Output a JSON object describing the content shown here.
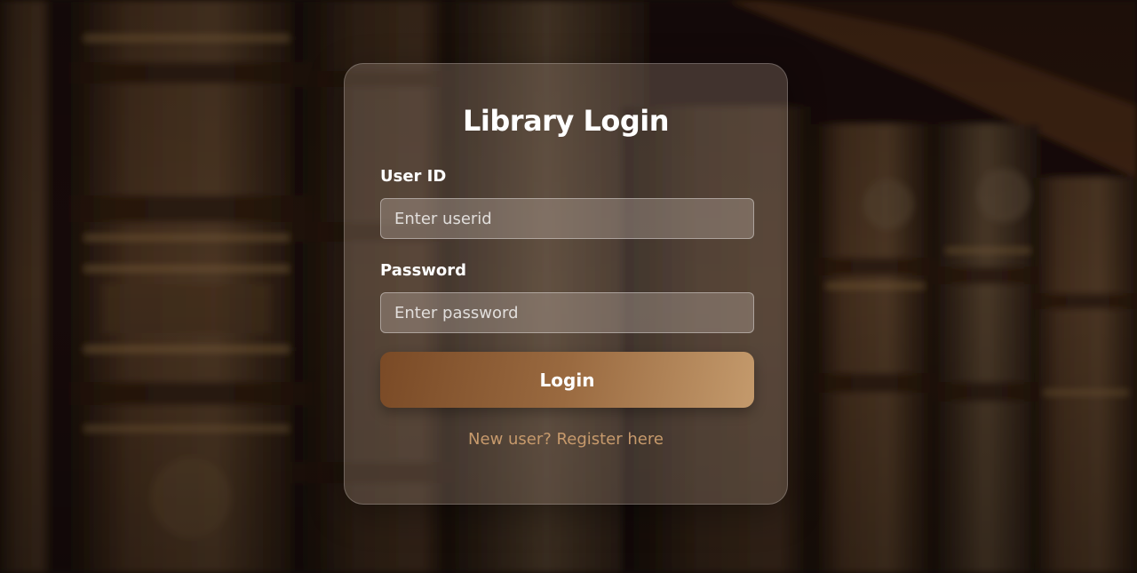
{
  "login": {
    "title": "Library Login",
    "userid_label": "User ID",
    "userid_placeholder": "Enter userid",
    "password_label": "Password",
    "password_placeholder": "Enter password",
    "button_label": "Login",
    "register_link": "New user? Register here"
  },
  "colors": {
    "button_gradient_start": "#7a4a26",
    "button_gradient_end": "#c49a6c",
    "link": "#c79a6c",
    "background": "#1a0e07"
  }
}
